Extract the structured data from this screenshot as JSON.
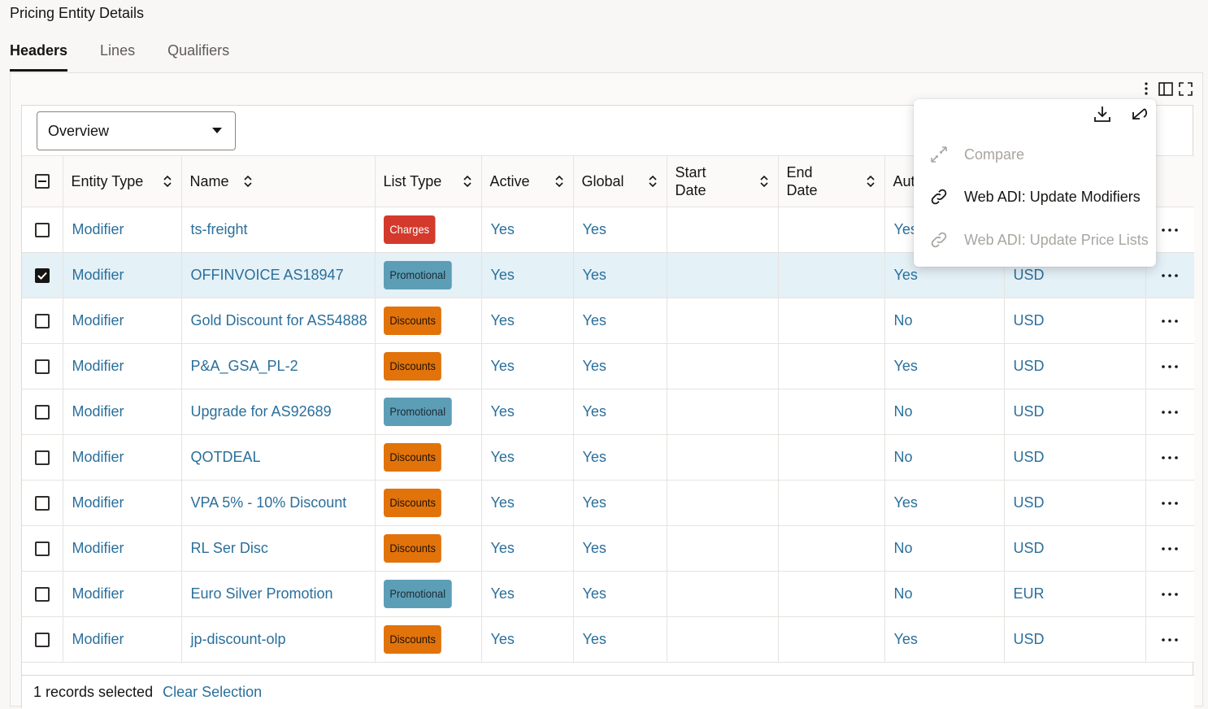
{
  "page": {
    "title": "Pricing Entity Details"
  },
  "tabs": [
    {
      "label": "Headers",
      "active": true
    },
    {
      "label": "Lines",
      "active": false
    },
    {
      "label": "Qualifiers",
      "active": false
    }
  ],
  "toolbar": {
    "icons": [
      "more-vertical-icon",
      "column-panel-icon",
      "fullscreen-icon"
    ]
  },
  "view_select": {
    "value": "Overview"
  },
  "table": {
    "columns": [
      {
        "key": "entity_type",
        "label": "Entity Type"
      },
      {
        "key": "name",
        "label": "Name"
      },
      {
        "key": "list_type",
        "label": "List Type"
      },
      {
        "key": "active",
        "label": "Active"
      },
      {
        "key": "global",
        "label": "Global"
      },
      {
        "key": "start_date",
        "label": "Start Date"
      },
      {
        "key": "end_date",
        "label": "End Date"
      },
      {
        "key": "automatic",
        "label": "Aut"
      },
      {
        "key": "currency",
        "label": ""
      }
    ],
    "rows": [
      {
        "selected": false,
        "entity_type": "Modifier",
        "name": "ts-freight",
        "list_type": "Charges",
        "active": "Yes",
        "global": "Yes",
        "start_date": "",
        "end_date": "",
        "automatic": "Yes",
        "currency": ""
      },
      {
        "selected": true,
        "entity_type": "Modifier",
        "name": "OFFINVOICE AS18947",
        "list_type": "Promotional",
        "active": "Yes",
        "global": "Yes",
        "start_date": "",
        "end_date": "",
        "automatic": "Yes",
        "currency": "USD"
      },
      {
        "selected": false,
        "entity_type": "Modifier",
        "name": "Gold Discount for AS54888",
        "list_type": "Discounts",
        "active": "Yes",
        "global": "Yes",
        "start_date": "",
        "end_date": "",
        "automatic": "No",
        "currency": "USD"
      },
      {
        "selected": false,
        "entity_type": "Modifier",
        "name": "P&A_GSA_PL-2",
        "list_type": "Discounts",
        "active": "Yes",
        "global": "Yes",
        "start_date": "",
        "end_date": "",
        "automatic": "Yes",
        "currency": "USD"
      },
      {
        "selected": false,
        "entity_type": "Modifier",
        "name": "Upgrade for AS92689",
        "list_type": "Promotional",
        "active": "Yes",
        "global": "Yes",
        "start_date": "",
        "end_date": "",
        "automatic": "No",
        "currency": "USD"
      },
      {
        "selected": false,
        "entity_type": "Modifier",
        "name": "QOTDEAL",
        "list_type": "Discounts",
        "active": "Yes",
        "global": "Yes",
        "start_date": "",
        "end_date": "",
        "automatic": "No",
        "currency": "USD"
      },
      {
        "selected": false,
        "entity_type": "Modifier",
        "name": "VPA 5% - 10% Discount",
        "list_type": "Discounts",
        "active": "Yes",
        "global": "Yes",
        "start_date": "",
        "end_date": "",
        "automatic": "Yes",
        "currency": "USD"
      },
      {
        "selected": false,
        "entity_type": "Modifier",
        "name": "RL Ser Disc",
        "list_type": "Discounts",
        "active": "Yes",
        "global": "Yes",
        "start_date": "",
        "end_date": "",
        "automatic": "No",
        "currency": "USD"
      },
      {
        "selected": false,
        "entity_type": "Modifier",
        "name": "Euro Silver Promotion",
        "list_type": "Promotional",
        "active": "Yes",
        "global": "Yes",
        "start_date": "",
        "end_date": "",
        "automatic": "No",
        "currency": "EUR"
      },
      {
        "selected": false,
        "entity_type": "Modifier",
        "name": "jp-discount-olp",
        "list_type": "Discounts",
        "active": "Yes",
        "global": "Yes",
        "start_date": "",
        "end_date": "",
        "automatic": "Yes",
        "currency": "USD"
      }
    ]
  },
  "badge_colors": {
    "Charges": "#d33a2b",
    "Promotional": "#5d9eb7",
    "Discounts": "#e2730a"
  },
  "footer": {
    "selected_text": "1 records selected",
    "clear_label": "Clear Selection"
  },
  "popup": {
    "tools": [
      "download-icon",
      "undo-icon"
    ],
    "items": [
      {
        "label": "Compare",
        "icon": "compare-icon",
        "disabled": true
      },
      {
        "label": "Web ADI: Update Modifiers",
        "icon": "link-icon",
        "disabled": false
      },
      {
        "label": "Web ADI: Update Price Lists",
        "icon": "link-icon",
        "disabled": true
      }
    ]
  },
  "colors": {
    "link": "#2a6f9b",
    "selected_row": "#e4f1f7"
  }
}
